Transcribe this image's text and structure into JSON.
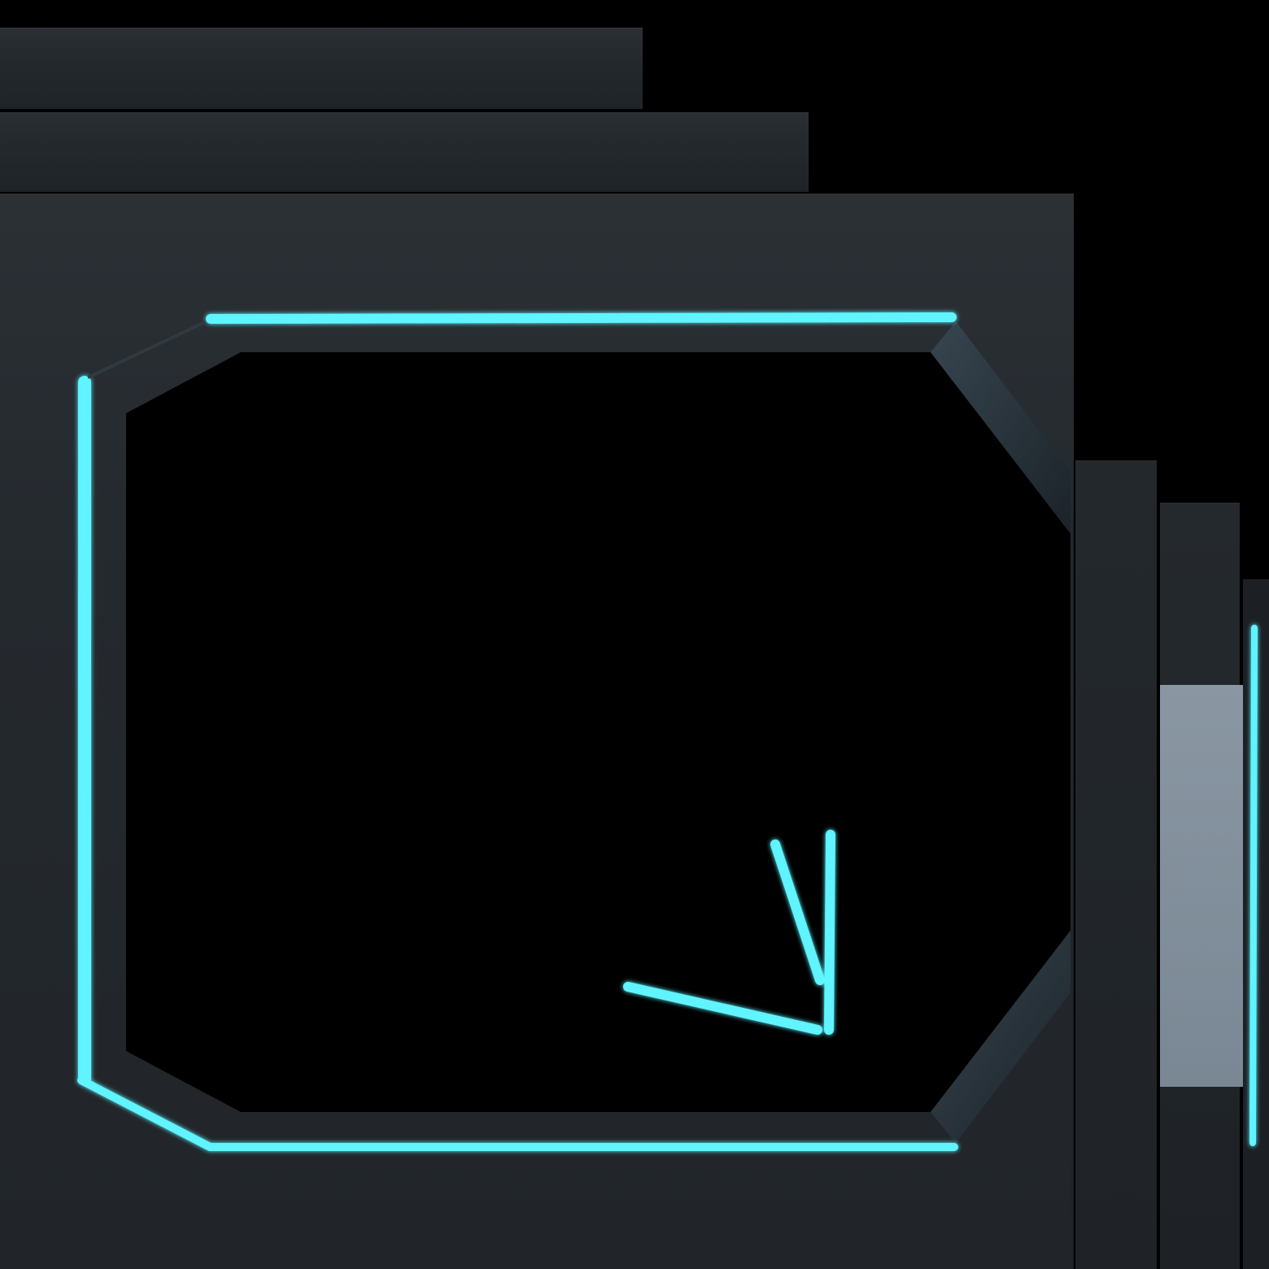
{
  "scene": {
    "background_color": "#000000",
    "panel_color": "#24292e",
    "screen_color": "#000000",
    "accent_color": "#5ff4ff",
    "highlight_color": "#8390a0"
  },
  "icons": {
    "corner_glyph": "check-angle-icon",
    "frame": "octagon-frame-icon"
  }
}
